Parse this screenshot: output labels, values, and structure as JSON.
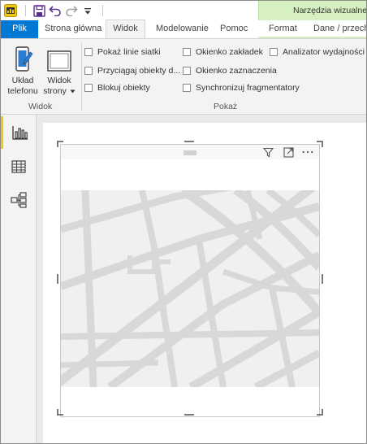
{
  "app": {
    "context_tab_label": "Narzędzia wizualne"
  },
  "tabs": {
    "file": "Plik",
    "home": "Strona główna",
    "view": "Widok",
    "modeling": "Modelowanie",
    "help": "Pomoc",
    "format": "Format",
    "data_drill": "Dane / przechodzenie"
  },
  "ribbon": {
    "view_group": {
      "label": "Widok",
      "phone_layout_line1": "Układ",
      "phone_layout_line2": "telefonu",
      "page_view_line1": "Widok",
      "page_view_line2": "strony"
    },
    "show_group": {
      "label": "Pokaż",
      "checkboxes": {
        "gridlines": "Pokaż linie siatki",
        "snap_to_grid": "Przyciągaj obiekty d...",
        "lock_objects": "Blokuj obiekty",
        "bookmarks_pane": "Okienko zakładek",
        "selection_pane": "Okienko zaznaczenia",
        "sync_slicers": "Synchronizuj fragmentatory",
        "performance_analyzer": "Analizator wydajności"
      }
    }
  },
  "rail": {
    "active_view": "report"
  },
  "colors": {
    "file_tab": "#0078d4",
    "context_tab": "#d6f0c2",
    "rail_accent": "#f2c811"
  }
}
